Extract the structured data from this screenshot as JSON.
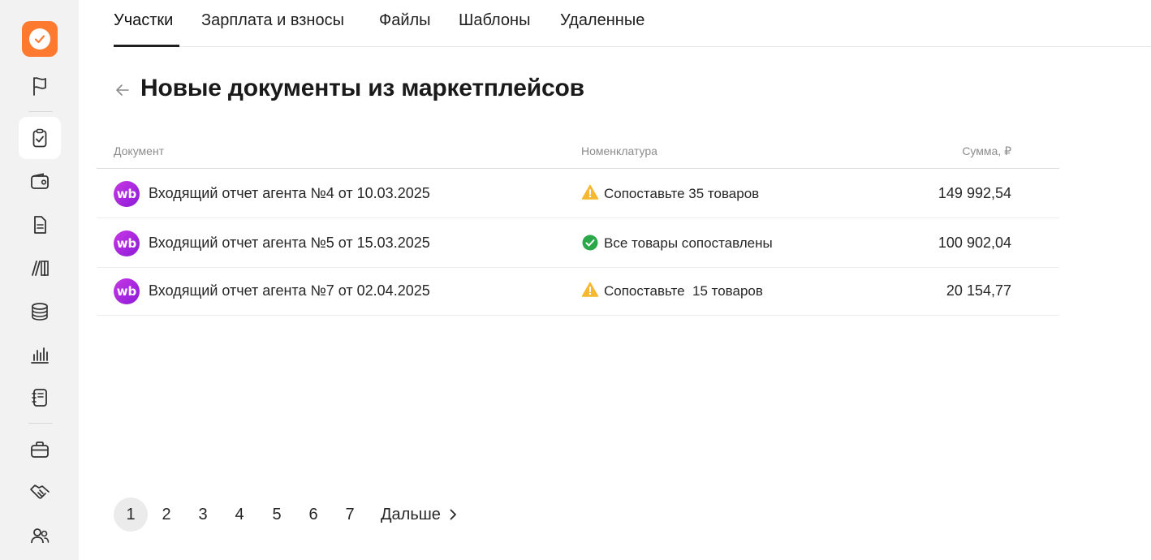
{
  "sidebar": {
    "logo": "checkmark-logo-icon",
    "items": [
      {
        "icon": "flag-icon"
      },
      {
        "icon": "clipboard-check-icon",
        "active": true
      },
      {
        "icon": "wallet-icon"
      },
      {
        "icon": "document-icon"
      },
      {
        "icon": "books-icon"
      },
      {
        "icon": "database-icon"
      },
      {
        "icon": "bar-chart-icon"
      },
      {
        "icon": "notebook-icon"
      },
      {
        "icon": "briefcase-icon"
      },
      {
        "icon": "handshake-icon"
      },
      {
        "icon": "users-icon"
      }
    ]
  },
  "tabs": [
    {
      "label": "Участки",
      "active": true
    },
    {
      "label": "Зарплата и взносы"
    },
    {
      "label": "Файлы"
    },
    {
      "label": "Шаблоны"
    },
    {
      "label": "Удаленные"
    }
  ],
  "page": {
    "title": "Новые документы из маркетплейсов"
  },
  "table": {
    "headers": {
      "document": "Документ",
      "nomenclature": "Номенклатура",
      "sum": "Сумма, ₽"
    },
    "rows": [
      {
        "marketplace": "wb",
        "document": "Входящий отчет агента №4 от 10.03.2025",
        "status_type": "warning",
        "status": "Сопоставьте 35 товаров",
        "sum": "149 992,54"
      },
      {
        "marketplace": "wb",
        "document": "Входящий отчет агента №5 от 15.03.2025",
        "status_type": "success",
        "status": "Все товары сопоставлены",
        "sum": "100 902,04"
      },
      {
        "marketplace": "wb",
        "document": "Входящий отчет агента №7 от 02.04.2025",
        "status_type": "warning",
        "status": "Сопоставьте  15 товаров",
        "sum": "20 154,77"
      }
    ]
  },
  "pagination": {
    "pages": [
      "1",
      "2",
      "3",
      "4",
      "5",
      "6",
      "7"
    ],
    "current": "1",
    "next_label": "Дальше"
  },
  "colors": {
    "brand": "#ff7a2f",
    "wb_gradient_start": "#c837e6",
    "wb_gradient_end": "#8b1bd6",
    "warning": "#f5b82e",
    "success": "#2aa84a"
  }
}
